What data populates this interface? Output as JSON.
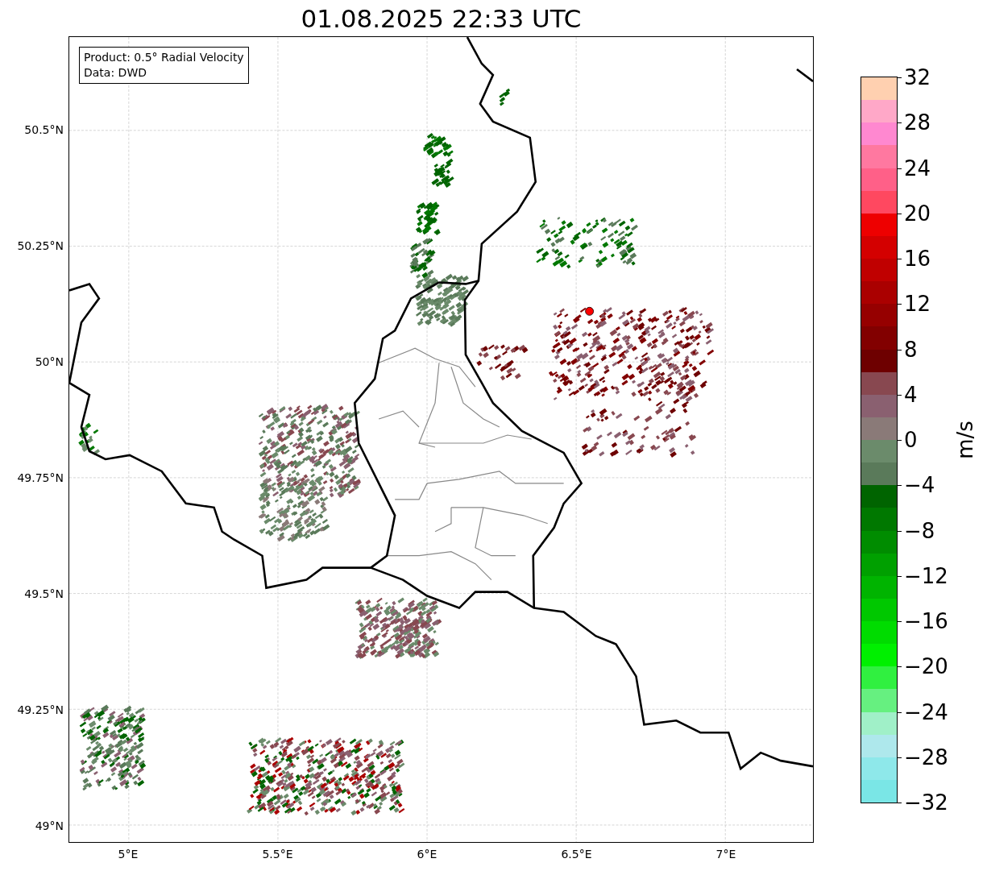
{
  "title": "01.08.2025 22:33 UTC",
  "legend": [
    "Product: 0.5° Radial Velocity",
    "Data: DWD"
  ],
  "map": {
    "lat_ticks": [
      "50.5°N",
      "50.25°N",
      "50°N",
      "49.75°N",
      "49.5°N",
      "49.25°N",
      "49°N"
    ],
    "lon_ticks": [
      "5°E",
      "5.5°E",
      "6°E",
      "6.5°E",
      "7°E"
    ]
  },
  "colorbar": {
    "label": "m/s",
    "ticks": [
      "32",
      "28",
      "24",
      "20",
      "16",
      "12",
      "8",
      "4",
      "0",
      "−4",
      "−8",
      "−12",
      "−16",
      "−20",
      "−24",
      "−28",
      "−32"
    ],
    "segments": [
      {
        "color": "#ffd0b0"
      },
      {
        "color": "#ffa8c8"
      },
      {
        "color": "#ff88d0"
      },
      {
        "color": "#ff78a0"
      },
      {
        "color": "#ff6088"
      },
      {
        "color": "#ff4860"
      },
      {
        "color": "#ee0000"
      },
      {
        "color": "#d40000"
      },
      {
        "color": "#c00000"
      },
      {
        "color": "#aa0000"
      },
      {
        "color": "#960000"
      },
      {
        "color": "#820000"
      },
      {
        "color": "#6e0000"
      },
      {
        "color": "#884850"
      },
      {
        "color": "#8a6070"
      },
      {
        "color": "#8a7a78"
      },
      {
        "color": "#6b8b6b"
      },
      {
        "color": "#5a7a5a"
      },
      {
        "color": "#006400"
      },
      {
        "color": "#007800"
      },
      {
        "color": "#008c00"
      },
      {
        "color": "#00a000"
      },
      {
        "color": "#00b400"
      },
      {
        "color": "#00c800"
      },
      {
        "color": "#00dc00"
      },
      {
        "color": "#00f000"
      },
      {
        "color": "#30f040"
      },
      {
        "color": "#66f080"
      },
      {
        "color": "#a0f0c8"
      },
      {
        "color": "#aee8ec"
      },
      {
        "color": "#8ee8ea"
      },
      {
        "color": "#7ae6e6"
      }
    ]
  }
}
